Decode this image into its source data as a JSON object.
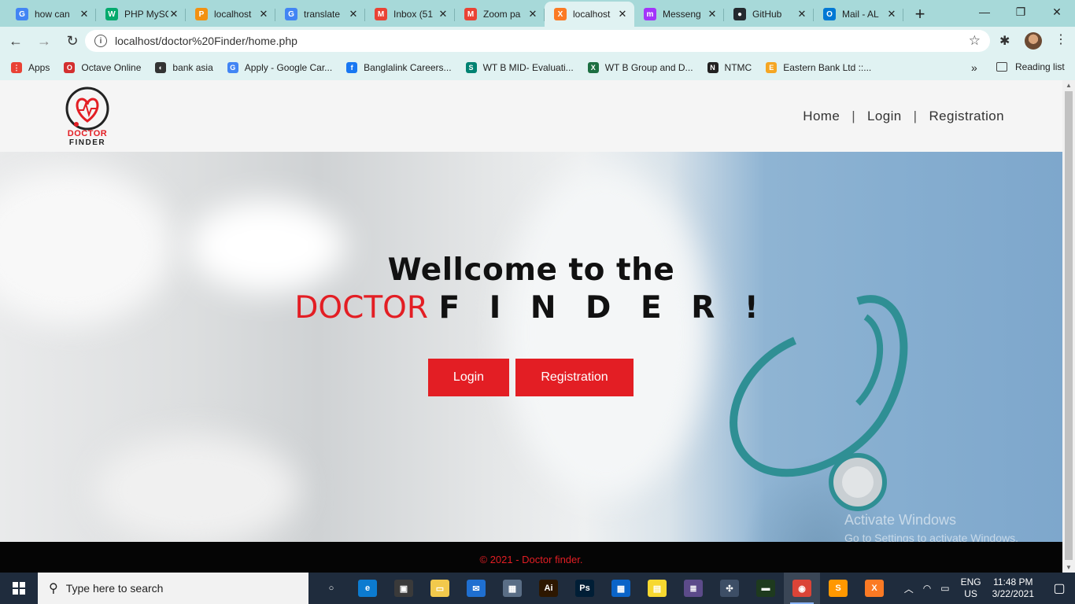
{
  "browser": {
    "tabs": [
      {
        "title": "how can",
        "icon": "google-icon",
        "color": "#4285f4",
        "glyph": "G"
      },
      {
        "title": "PHP MySQ",
        "icon": "w3schools-icon",
        "color": "#04aa6d",
        "glyph": "W"
      },
      {
        "title": "localhost",
        "icon": "phpmyadmin-icon",
        "color": "#f29111",
        "glyph": "P"
      },
      {
        "title": "translate",
        "icon": "google-icon",
        "color": "#4285f4",
        "glyph": "G"
      },
      {
        "title": "Inbox (51",
        "icon": "gmail-icon",
        "color": "#ea4335",
        "glyph": "M"
      },
      {
        "title": "Zoom pa",
        "icon": "gmail-icon",
        "color": "#ea4335",
        "glyph": "M"
      },
      {
        "title": "localhost",
        "icon": "xampp-icon",
        "color": "#fb7a24",
        "glyph": "X",
        "active": true
      },
      {
        "title": "Messeng",
        "icon": "messenger-icon",
        "color": "#a334fa",
        "glyph": "m"
      },
      {
        "title": "GitHub",
        "icon": "github-icon",
        "color": "#24292e",
        "glyph": "●"
      },
      {
        "title": "Mail - AL",
        "icon": "outlook-icon",
        "color": "#0078d4",
        "glyph": "O"
      }
    ],
    "url": "localhost/doctor%20Finder/home.php",
    "bookmarks": [
      {
        "label": "Apps",
        "icon": "apps-grid-icon",
        "color": "#e94235",
        "glyph": "⋮"
      },
      {
        "label": "Octave Online",
        "icon": "octave-icon",
        "color": "#d32f2f",
        "glyph": "O"
      },
      {
        "label": "bank asia",
        "icon": "globe-icon",
        "color": "#333333",
        "glyph": "◐"
      },
      {
        "label": "Apply - Google Car...",
        "icon": "google-icon",
        "color": "#4285f4",
        "glyph": "G"
      },
      {
        "label": "Banglalink Careers...",
        "icon": "facebook-icon",
        "color": "#1877f2",
        "glyph": "f"
      },
      {
        "label": "WT B MID- Evaluati...",
        "icon": "sway-icon",
        "color": "#008272",
        "glyph": "S"
      },
      {
        "label": "WT B Group and D...",
        "icon": "excel-icon",
        "color": "#1d6f42",
        "glyph": "X"
      },
      {
        "label": "NTMC",
        "icon": "ntmc-icon",
        "color": "#222222",
        "glyph": "N"
      },
      {
        "label": "Eastern Bank Ltd ::...",
        "icon": "ebl-icon",
        "color": "#f5a623",
        "glyph": "E"
      }
    ],
    "reading_list": "Reading list"
  },
  "site": {
    "logo": {
      "line1": "DOCTOR",
      "line2": "FINDER"
    },
    "nav": {
      "home": "Home",
      "login": "Login",
      "registration": "Registration",
      "separator": "|"
    },
    "hero": {
      "title": "Wellcome to the",
      "highlight": "DOCTOR",
      "rest": "F I N D E R !",
      "login_button": "Login",
      "registration_button": "Registration"
    },
    "watermark": {
      "line1": "Activate Windows",
      "line2": "Go to Settings to activate Windows."
    },
    "footer": "© 2021 - Doctor finder."
  },
  "taskbar": {
    "search_placeholder": "Type here to search",
    "apps": [
      {
        "name": "task-view-icon",
        "color": "transparent",
        "glyph": "○"
      },
      {
        "name": "edge-icon",
        "color": "#0c7bd0",
        "glyph": "e"
      },
      {
        "name": "store-icon",
        "color": "#3a3a3a",
        "glyph": "▣"
      },
      {
        "name": "file-explorer-icon",
        "color": "#f2c94c",
        "glyph": "▭"
      },
      {
        "name": "mail-icon",
        "color": "#1f6fd0",
        "glyph": "✉"
      },
      {
        "name": "calculator-icon",
        "color": "#5a6e86",
        "glyph": "▦"
      },
      {
        "name": "illustrator-icon",
        "color": "#2d1700",
        "glyph": "Ai"
      },
      {
        "name": "photoshop-icon",
        "color": "#001e36",
        "glyph": "Ps"
      },
      {
        "name": "calendar-icon",
        "color": "#0a64c8",
        "glyph": "▦"
      },
      {
        "name": "sticky-notes-icon",
        "color": "#f7d830",
        "glyph": "▤"
      },
      {
        "name": "settings-app-icon",
        "color": "#5c4b8a",
        "glyph": "≣"
      },
      {
        "name": "network-app-icon",
        "color": "#3d4e66",
        "glyph": "✣"
      },
      {
        "name": "terminal-icon",
        "color": "#1e3a1e",
        "glyph": "▬"
      },
      {
        "name": "chrome-icon",
        "color": "#db4437",
        "glyph": "◉",
        "active": true
      },
      {
        "name": "sublime-icon",
        "color": "#ff9800",
        "glyph": "S"
      },
      {
        "name": "xampp-tb-icon",
        "color": "#fb7a24",
        "glyph": "X"
      }
    ],
    "lang": "ENG",
    "region": "US",
    "time": "11:48 PM",
    "date": "3/22/2021"
  }
}
